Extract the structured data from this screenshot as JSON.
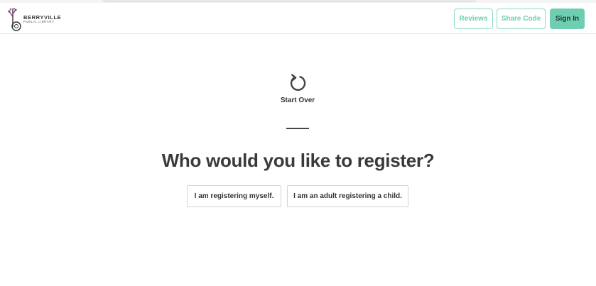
{
  "header": {
    "logo": {
      "name": "BERRYVILLE",
      "subtitle": "PUBLIC LIBRARY",
      "icon": "library-logo-b-icon"
    },
    "buttons": {
      "reviews": "Reviews",
      "share_code": "Share Code",
      "sign_in": "Sign In"
    }
  },
  "main": {
    "start_over": {
      "label": "Start Over",
      "icon": "refresh-icon"
    },
    "question": "Who would you like to register?",
    "options": [
      {
        "label": "I am registering myself."
      },
      {
        "label": "I am an adult registering a child."
      }
    ]
  },
  "colors": {
    "accent": "#6fcdb2",
    "accent_border": "#8fdcc5",
    "logo_purple": "#8e3a8f",
    "text_dark": "#3a3a3a"
  }
}
